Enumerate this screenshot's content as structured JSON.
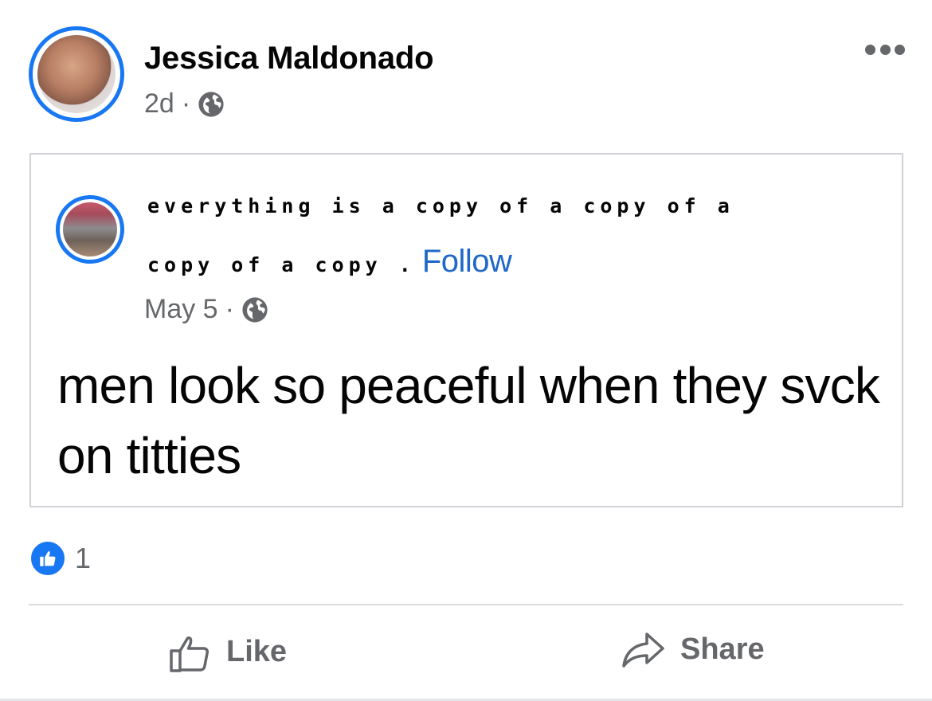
{
  "post": {
    "author": "Jessica Maldonado",
    "time": "2d",
    "separator": "·",
    "icons": {
      "privacy": "globe-icon",
      "more": "more-options-icon"
    }
  },
  "shared_post": {
    "author_line1": "everything is a copy of a copy of a",
    "author_line2": "copy of a copy .",
    "follow_label": "Follow",
    "time": "May 5",
    "separator": "·",
    "text": "men look so peaceful when they svck on titties",
    "colors": {
      "follow": "#1f68c7",
      "ring": "#1877f2"
    }
  },
  "reactions": {
    "icon": "like-reaction-icon",
    "count": "1"
  },
  "actions": {
    "like_label": "Like",
    "share_label": "Share"
  }
}
